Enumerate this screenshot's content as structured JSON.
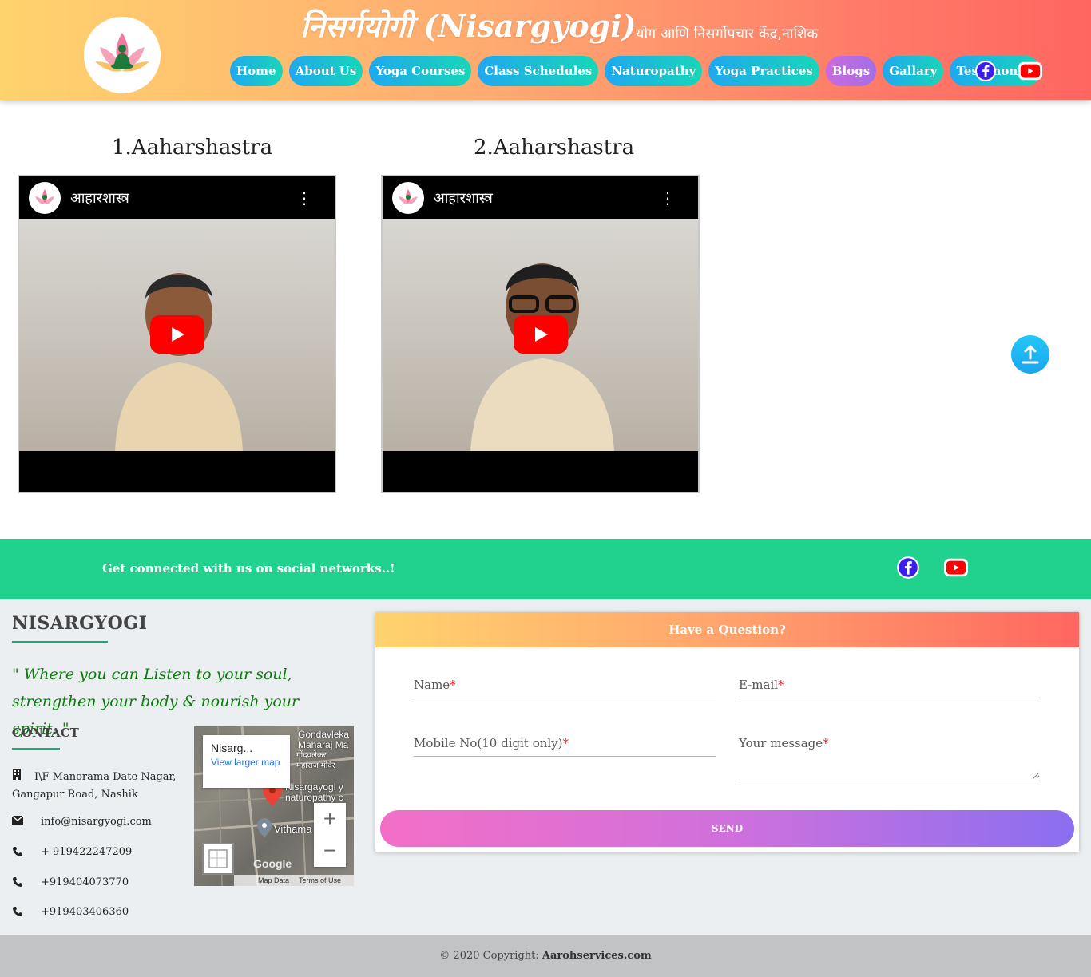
{
  "header": {
    "brand": "निसर्गयोगी (Nisargyogi)",
    "tagline": "योग आणि निसर्गोपचार केंद्र,नाशिक",
    "nav": [
      {
        "label": "Home",
        "active": false
      },
      {
        "label": "About Us",
        "active": false
      },
      {
        "label": "Yoga Courses",
        "active": false
      },
      {
        "label": "Class Schedules",
        "active": false
      },
      {
        "label": "Naturopathy",
        "active": false
      },
      {
        "label": "Yoga Practices",
        "active": false
      },
      {
        "label": "Blogs",
        "active": true
      },
      {
        "label": "Gallary",
        "active": false
      },
      {
        "label": "Testimonial",
        "active": false
      }
    ]
  },
  "videos": [
    {
      "title": "1.Aaharshastra",
      "video_title": "आहारशास्त्र"
    },
    {
      "title": "2.Aaharshastra",
      "video_title": "आहारशास्त्र"
    }
  ],
  "social_band": {
    "text": "Get connected with us on social networks..!"
  },
  "footer": {
    "brand": "NISARGYOGI",
    "quote": "\" Where you can Listen to your soul, strengthen your body & nourish your spirit. \"",
    "contact_heading": "CONTACT",
    "address_line1": "I\\F Manorama Date Nagar,",
    "address_line2": "Gangapur Road, Nashik",
    "email": "info@nisargyogi.com",
    "phones": [
      "+ 919422247209",
      "+919404073770",
      "+919403406360"
    ]
  },
  "map": {
    "place_name": "Nisarg...",
    "view_larger": "View larger map",
    "label_gondavlekar": "Gondavleka\nMaharaj Ma",
    "label_marathi": "गोंदवलेकर\nमहाराज मंदिर",
    "label_nisargayogi": "Nisargayogi y\nnaturopathy c",
    "label_vithama": "Vithama",
    "google": "Google",
    "map_data": "Map Data",
    "terms": "Terms of Use"
  },
  "form": {
    "heading": "Have a Question?",
    "name_label": "Name",
    "email_label": "E-mail",
    "mobile_label": "Mobile No(10 digit only)",
    "message_label": "Your message",
    "required_mark": "*",
    "send_label": "SEND"
  },
  "copyright": {
    "prefix": "© 2020 Copyright:",
    "site": "Aarohservices.com"
  },
  "colors": {
    "header_gradient_start": "#ffd36e",
    "header_gradient_end": "#ff6660",
    "nav_gradient": "#1fa8f0",
    "nav_active": "#c96ae0",
    "band": "#21d18e",
    "quote": "#0e7a0e",
    "youtube_red": "#ff0000",
    "facebook": "#3b1ee8"
  },
  "icons": {
    "facebook": "facebook-icon",
    "youtube": "youtube-icon",
    "building": "building-icon",
    "envelope": "envelope-icon",
    "phone": "phone-icon",
    "arrow_up": "arrow-up-icon"
  }
}
